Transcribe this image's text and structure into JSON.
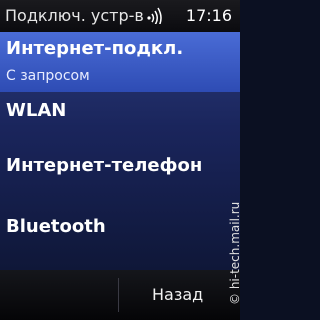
{
  "status_bar": {
    "title": "Подключ. устр-в",
    "time": "17:16",
    "icon": "signal-waves-icon"
  },
  "list": {
    "items": [
      {
        "label": "Интернет-подкл.",
        "sublabel": "С запросом",
        "selected": true
      },
      {
        "label": "WLAN"
      },
      {
        "label": "Интернет-телефон"
      },
      {
        "label": "Bluetooth"
      }
    ]
  },
  "softkeys": {
    "right": "Назад"
  },
  "watermark": "© hi-tech.mail.ru",
  "colors": {
    "selected": "#3a5ccc",
    "list_top": "#2a3a78",
    "list_bottom": "#0f1738"
  }
}
